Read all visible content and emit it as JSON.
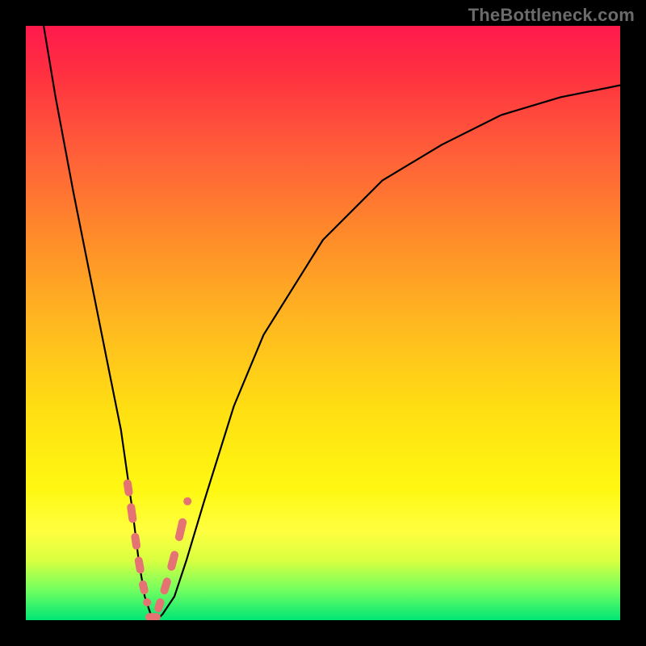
{
  "watermark": {
    "text": "TheBottleneck.com"
  },
  "chart_data": {
    "type": "line",
    "title": "",
    "xlabel": "",
    "ylabel": "",
    "xlim": [
      0,
      100
    ],
    "ylim": [
      0,
      100
    ],
    "grid": false,
    "series": [
      {
        "name": "curve",
        "x": [
          3,
          5,
          8,
          10,
          12,
          14,
          16,
          18,
          19,
          20,
          21,
          22,
          23,
          25,
          27,
          30,
          35,
          40,
          50,
          60,
          70,
          80,
          90,
          100
        ],
        "y": [
          100,
          88,
          72,
          62,
          52,
          42,
          32,
          18,
          10,
          4,
          1,
          0,
          1,
          4,
          10,
          20,
          36,
          48,
          64,
          74,
          80,
          85,
          88,
          90
        ]
      }
    ],
    "annotations": {
      "dash_segments_left": [
        [
          17.1,
          23
        ],
        [
          17.7,
          19
        ],
        [
          18.4,
          14
        ],
        [
          19.0,
          10
        ],
        [
          19.7,
          6
        ],
        [
          20.4,
          3
        ]
      ],
      "dash_segments_right": [
        [
          22.3,
          2
        ],
        [
          23.3,
          5
        ],
        [
          24.5,
          9
        ],
        [
          25.8,
          14
        ],
        [
          27.2,
          20
        ]
      ],
      "minimum_floor": [
        [
          20.8,
          0.5
        ],
        [
          22.0,
          0.5
        ]
      ]
    },
    "colors": {
      "curve_stroke": "#000000",
      "dash_stroke": "#e57373",
      "background_top": "#ff1a4d",
      "background_bottom": "#00e676"
    }
  }
}
